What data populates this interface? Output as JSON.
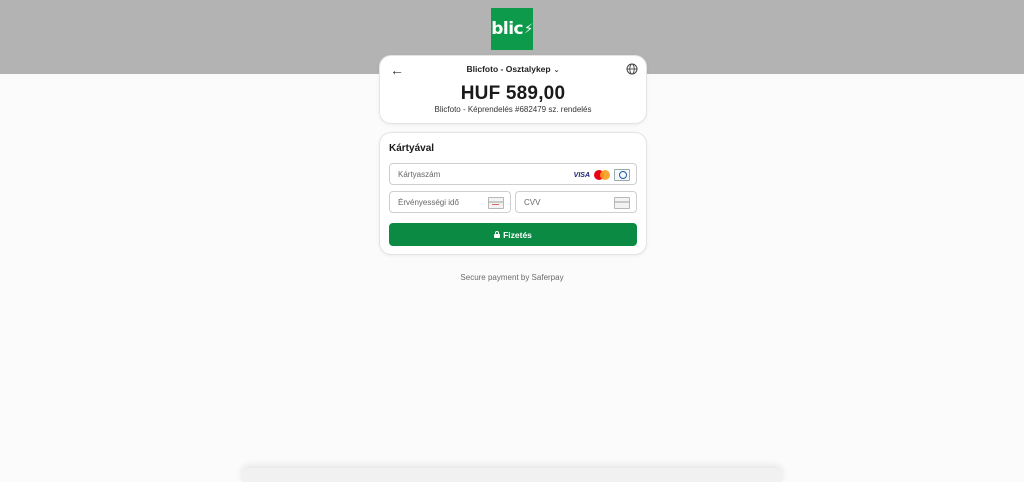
{
  "brand": {
    "logo_text": "blic",
    "logo_color": "#0d9a4a"
  },
  "header": {
    "merchant_selector": "Blicfoto - Osztalykep",
    "amount": "HUF 589,00",
    "order_description": "Blicfoto - Képrendelés #682479 sz. rendelés"
  },
  "payment": {
    "title": "Kártyával",
    "card_number_placeholder": "Kártyaszám",
    "expiry_placeholder": "Érvényességi idő",
    "cvv_placeholder": "CVV",
    "brand_visa": "VISA",
    "pay_button_label": "Fizetés",
    "pay_button_color": "#0a8a42"
  },
  "footer": {
    "secure_text": "Secure payment by Saferpay"
  }
}
